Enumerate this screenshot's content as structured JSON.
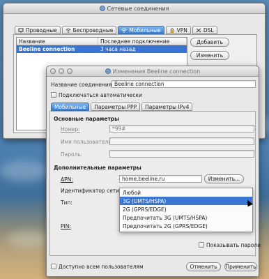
{
  "window1": {
    "title": "Сетевые соединения",
    "tabs": [
      {
        "label": "Проводные",
        "icon": "wired-icon"
      },
      {
        "label": "Беспроводные",
        "icon": "wireless-icon"
      },
      {
        "label": "Мобильные",
        "icon": "mobile-icon",
        "active": true
      },
      {
        "label": "VPN",
        "icon": "vpn-icon"
      },
      {
        "label": "DSL",
        "icon": "dsl-icon"
      }
    ],
    "columns": [
      "Название",
      "Последнее подключение"
    ],
    "rows": [
      {
        "name": "Beeline connection",
        "last": "3 часа назад",
        "selected": true
      }
    ],
    "buttons": {
      "add": "Добавить",
      "edit": "Изменить"
    }
  },
  "window2": {
    "title": "Изменения Beeline connection",
    "name_label": "Название соединения:",
    "name_value": "Beeline connection",
    "auto_connect_label": "Подключаться автоматически",
    "tabs": [
      "Мобильные",
      "Параметры PPP",
      "Параметры IPv4"
    ],
    "basic_section": "Основные параметры",
    "number_label": "Номер:",
    "number_value": "*99#",
    "username_label": "Имя пользователя:",
    "password_label": "Пароль:",
    "advanced_section": "Дополнительные параметры",
    "apn_label": "APN:",
    "apn_value": "home.beeline.ru",
    "apn_button": "Изменить...",
    "network_id_label": "Идентификатор сети:",
    "type_label": "Тип:",
    "pin_label": "PIN:",
    "show_passwords_label": "Показывать пароли",
    "all_users_label": "Доступно всем пользователям",
    "cancel": "Отменить",
    "apply": "Применить"
  },
  "dropdown": {
    "options": [
      "Любой",
      "3G (UMTS/HSPA)",
      "2G (GPRS/EDGE)",
      "Предпочитать 3G (UMTS/HSPA)",
      "Предпочитать 2G (GPRS/EDGE)"
    ],
    "selected": "3G (UMTS/HSPA)"
  },
  "colors": {
    "selection": "#3874d1",
    "active_tab": "#3b7fd0"
  }
}
